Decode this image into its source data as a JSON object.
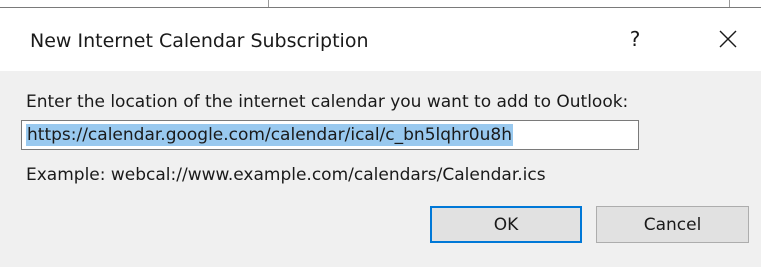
{
  "dialog": {
    "title": "New Internet Calendar Subscription",
    "help_label": "?",
    "close_icon": "close-icon",
    "prompt": "Enter the location of the internet calendar you want to add to Outlook:",
    "url_value": "https://calendar.google.com/calendar/ical/c_bn5lqhr0u8h",
    "example": "Example: webcal://www.example.com/calendars/Calendar.ics",
    "ok_label": "OK",
    "cancel_label": "Cancel"
  },
  "colors": {
    "background": "#f0f0f0",
    "titlebar": "#ffffff",
    "selection": "#99c9ef",
    "default_button_border": "#0078d7"
  }
}
